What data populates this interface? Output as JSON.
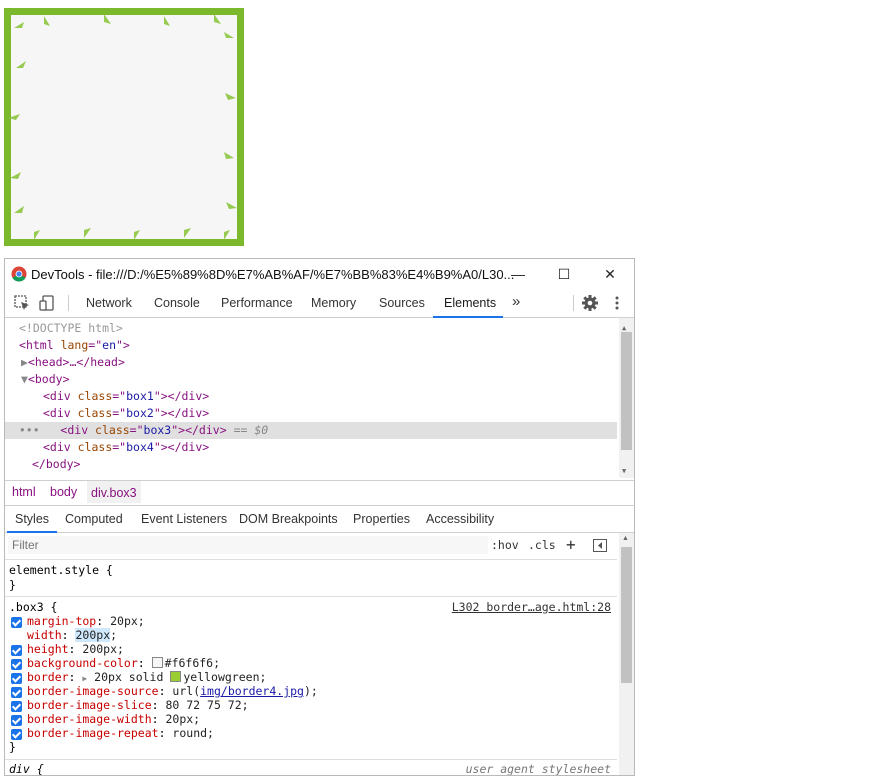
{
  "devtools": {
    "title": "DevTools - file:///D:/%E5%89%8D%E7%AB%AF/%E7%BB%83%E4%B9%A0/L30...",
    "window_buttons": {
      "minimize": "—",
      "maximize": "☐",
      "close": "✕"
    },
    "tabs": [
      "Network",
      "Console",
      "Performance",
      "Memory",
      "Sources",
      "Elements",
      "»"
    ],
    "active_tab": "Elements"
  },
  "dom": {
    "doctype": "<!DOCTYPE html>",
    "html_open": {
      "tag": "html",
      "attr": "lang",
      "value": "en"
    },
    "head": "<head>…</head>",
    "body_open": "body",
    "divs": [
      {
        "cls": "box1"
      },
      {
        "cls": "box2"
      },
      {
        "cls": "box3",
        "selected": true,
        "suffix": "== $0"
      },
      {
        "cls": "box4"
      }
    ],
    "body_close": "</body>",
    "selected_marker": "•••"
  },
  "breadcrumbs": [
    "html",
    "body",
    "div.box3"
  ],
  "style_tabs": [
    "Styles",
    "Computed",
    "Event Listeners",
    "DOM Breakpoints",
    "Properties",
    "Accessibility"
  ],
  "styles": {
    "filter_placeholder": "Filter",
    "hov": ":hov",
    "cls": ".cls",
    "plus": "+",
    "element_style": {
      "selector": "element.style {",
      "close": "}"
    },
    "box3_rule": {
      "selector": ".box3 {",
      "source": "L302 border…age.html:28",
      "props": [
        {
          "name": "margin-top",
          "value": "20px;",
          "checked": true
        },
        {
          "name": "width",
          "value_a": "20",
          "value_b": "0px",
          "value_c": ";",
          "checked": false
        },
        {
          "name": "height",
          "value": "200px;",
          "checked": true
        },
        {
          "name": "background-color",
          "value": "#f6f6f6;",
          "swatch": "#f6f6f6",
          "checked": true
        },
        {
          "name": "border",
          "value_pre": "20px solid ",
          "value": "yellowgreen;",
          "swatch": "#9acd32",
          "checked": true
        },
        {
          "name": "border-image-source",
          "value_pre": "url(",
          "link": "img/border4.jpg",
          "value": ");",
          "checked": true
        },
        {
          "name": "border-image-slice",
          "value": "80 72 75 72;",
          "checked": true
        },
        {
          "name": "border-image-width",
          "value": "20px;",
          "checked": true
        },
        {
          "name": "border-image-repeat",
          "value": "round;",
          "checked": true
        }
      ],
      "close": "}"
    },
    "ua_rule": {
      "selector": "div {",
      "source": "user agent stylesheet"
    }
  },
  "colors": {
    "accent": "#1a73e8",
    "border_green": "#7bb82c",
    "box_bg": "#f6f6f6"
  }
}
